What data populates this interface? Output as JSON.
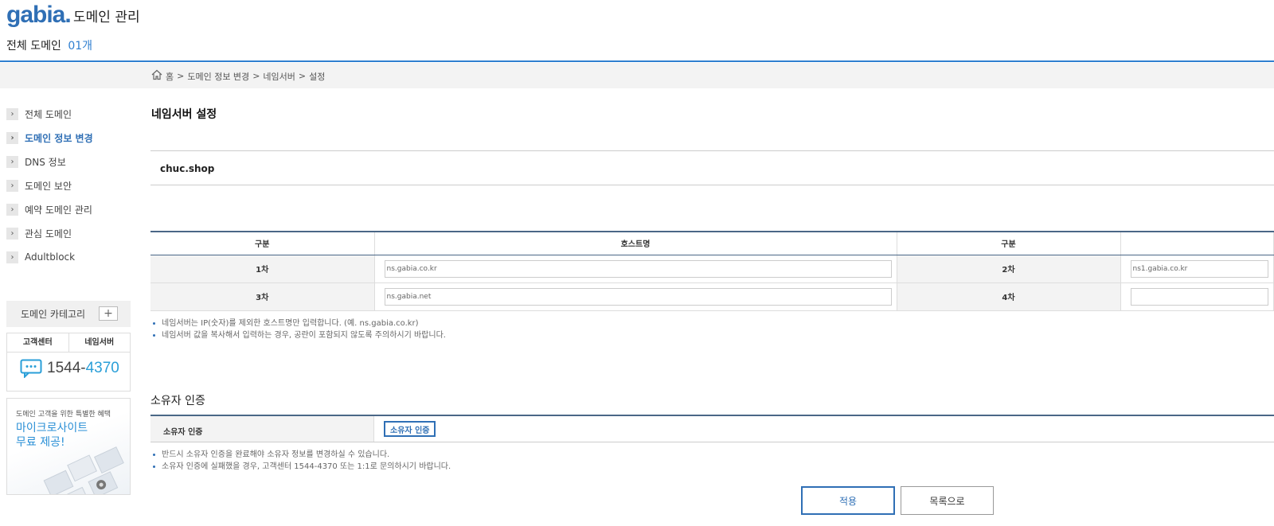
{
  "header": {
    "logo": "gabia.",
    "app_title": "도메인 관리",
    "total_label": "전체 도메인",
    "total_count": "01개"
  },
  "breadcrumb": [
    "홈",
    ">",
    "도메인 정보 변경",
    ">",
    "네임서버",
    ">",
    "설정"
  ],
  "sidebar": {
    "items": [
      {
        "label": "전체 도메인",
        "active": false
      },
      {
        "label": "도메인 정보 변경",
        "active": true
      },
      {
        "label": "DNS 정보",
        "active": false
      },
      {
        "label": "도메인 보안",
        "active": false
      },
      {
        "label": "예약 도메인 관리",
        "active": false
      },
      {
        "label": "관심 도메인",
        "active": false
      },
      {
        "label": "Adultblock",
        "active": false
      }
    ],
    "category_label": "도메인 카테고리",
    "support": {
      "tab1": "고객센터",
      "tab2": "네임서버",
      "phone_prefix": "1544-",
      "phone_suffix": "4370"
    },
    "promo": {
      "small": "도메인 고객을 위한 특별한 혜택",
      "line1": "마이크로사이트",
      "line2": "무료 제공!"
    }
  },
  "main": {
    "page_title": "네임서버 설정",
    "domain": "chuc.shop",
    "table": {
      "headers": [
        "구분",
        "호스트명",
        "구분",
        ""
      ],
      "rows": [
        {
          "label_a": "1차",
          "value_a": "ns.gabia.co.kr",
          "label_b": "2차",
          "value_b": "ns1.gabia.co.kr"
        },
        {
          "label_a": "3차",
          "value_a": "ns.gabia.net",
          "label_b": "4차",
          "value_b": ""
        }
      ]
    },
    "notes": [
      "네임서버는 IP(숫자)를 제외한 호스트명만 입력합니다. (예. ns.gabia.co.kr)",
      "네임서버 값을 복사해서 입력하는 경우, 공란이 포함되지 않도록 주의하시기 바랍니다."
    ],
    "owner": {
      "title": "소유자 인증",
      "label": "소유자 인증",
      "button": "소유자 인증",
      "notes": [
        "반드시 소유자 인증을 완료해야 소유자 정보를 변경하실 수 있습니다.",
        "소유자 인증에 실패했을 경우, 고객센터 1544-4370 또는 1:1로 문의하시기 바랍니다."
      ]
    },
    "buttons": {
      "apply": "적용",
      "list": "목록으로"
    }
  },
  "colors": {
    "accent": "#2f6fb5",
    "header_line": "#2f7fd0",
    "table_line": "#4a6787"
  }
}
